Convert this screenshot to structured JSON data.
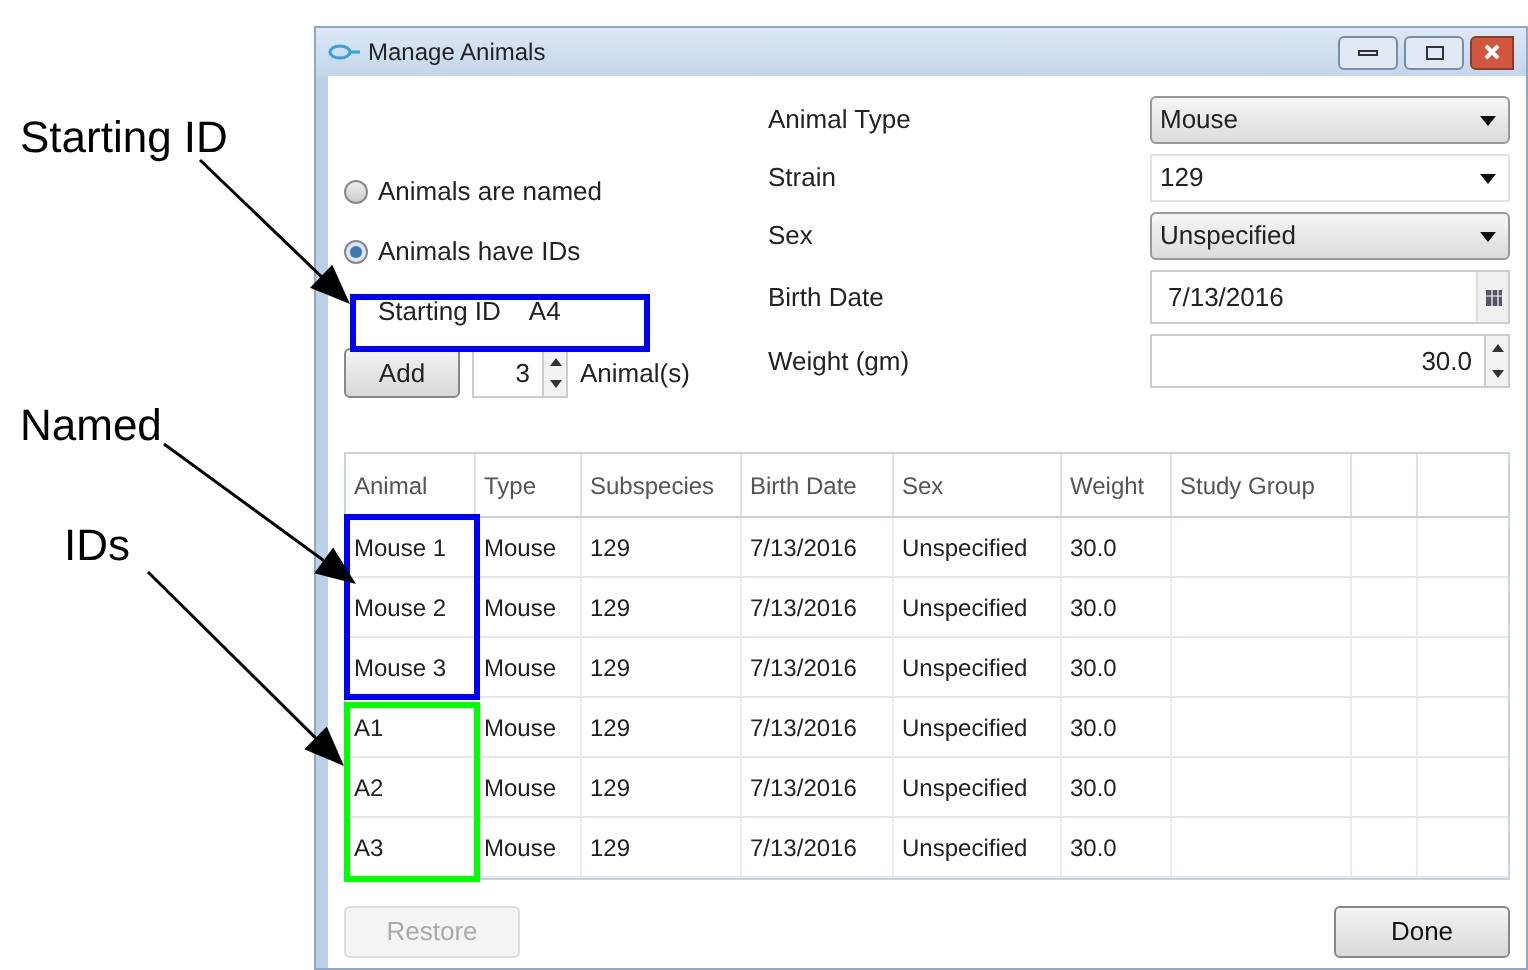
{
  "window": {
    "title": "Manage Animals"
  },
  "callouts": [
    {
      "text": "Starting ID",
      "kind": "top"
    },
    {
      "text": "Named",
      "kind": "middle"
    },
    {
      "text": "IDs",
      "kind": "bottom"
    }
  ],
  "highlights": [
    {
      "kind": "starting",
      "color": "#0000ff"
    },
    {
      "kind": "named",
      "color": "#0000ff"
    },
    {
      "kind": "ids",
      "color": "#00ff00"
    }
  ],
  "radios": [
    {
      "label": "Animals are named",
      "selected": false
    },
    {
      "label": "Animals have IDs",
      "selected": true
    }
  ],
  "starting_id": {
    "label": "Starting ID",
    "value": "A4"
  },
  "add_button": "Add",
  "count": "3",
  "count_label": "Animal(s)",
  "fields": [
    {
      "label": "Animal Type",
      "value": "Mouse",
      "kind": "combo"
    },
    {
      "label": "Strain",
      "value": "129",
      "kind": "editable"
    },
    {
      "label": "Sex",
      "value": "Unspecified",
      "kind": "combo"
    },
    {
      "label": "Birth Date",
      "value": "7/13/2016",
      "kind": "date"
    },
    {
      "label": "Weight (gm)",
      "value": "30.0",
      "kind": "number"
    }
  ],
  "table": {
    "columns": [
      "Animal",
      "Type",
      "Subspecies",
      "Birth Date",
      "Sex",
      "Weight",
      "Study Group"
    ],
    "rows": [
      [
        "Mouse 1",
        "Mouse",
        "129",
        "7/13/2016",
        "Unspecified",
        "30.0"
      ],
      [
        "Mouse 2",
        "Mouse",
        "129",
        "7/13/2016",
        "Unspecified",
        "30.0"
      ],
      [
        "Mouse 3",
        "Mouse",
        "129",
        "7/13/2016",
        "Unspecified",
        "30.0"
      ],
      [
        "A1",
        "Mouse",
        "129",
        "7/13/2016",
        "Unspecified",
        "30.0"
      ],
      [
        "A2",
        "Mouse",
        "129",
        "7/13/2016",
        "Unspecified",
        "30.0"
      ],
      [
        "A3",
        "Mouse",
        "129",
        "7/13/2016",
        "Unspecified",
        "30.0"
      ]
    ]
  },
  "buttons": [
    {
      "label": "Restore",
      "disabled": true
    },
    {
      "label": "Done",
      "disabled": false
    }
  ]
}
